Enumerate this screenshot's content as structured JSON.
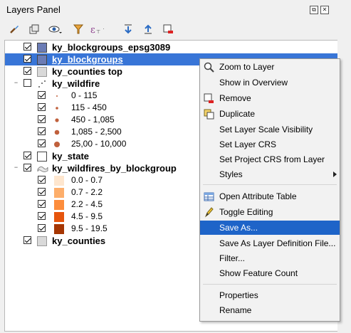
{
  "panel": {
    "title": "Layers Panel"
  },
  "window_buttons": {
    "float": "⧉",
    "close": "✕"
  },
  "layers": [
    {
      "label": "ky_blockgroups_epsg3089",
      "checked": true,
      "swatch": "#6b7cb5"
    },
    {
      "label": "ky_blockgroups",
      "checked": true,
      "swatch": "#6b7cb5",
      "selected": true
    },
    {
      "label": "ky_counties top",
      "checked": true,
      "swatch": "#d9d9d9"
    },
    {
      "label": "ky_wildfire",
      "checked": false
    },
    {
      "label": "ky_state",
      "checked": true
    },
    {
      "label": "ky_wildfires_by_blockgroup",
      "checked": true
    },
    {
      "label": "ky_counties",
      "checked": true,
      "swatch": "#d9d9d9"
    }
  ],
  "wildfire_classes": [
    {
      "label": "0 - 115",
      "color": "#c0603c"
    },
    {
      "label": "115 - 450",
      "color": "#c0603c"
    },
    {
      "label": "450 - 1,085",
      "color": "#c0603c"
    },
    {
      "label": "1,085 - 2,500",
      "color": "#c0603c"
    },
    {
      "label": "25,00 - 10,000",
      "color": "#c0603c"
    }
  ],
  "blockgroup_classes": [
    {
      "label": "0.0 - 0.7",
      "color": "#fee6ce"
    },
    {
      "label": "0.7 - 2.2",
      "color": "#fdae6b"
    },
    {
      "label": "2.2 - 4.5",
      "color": "#fd8d3c"
    },
    {
      "label": "4.5 - 9.5",
      "color": "#e6550d"
    },
    {
      "label": "9.5 - 19.5",
      "color": "#a63603"
    }
  ],
  "context_menu": {
    "items": [
      {
        "label": "Zoom to Layer",
        "icon": "zoom-icon"
      },
      {
        "label": "Show in Overview"
      },
      {
        "label": "Remove",
        "icon": "remove-icon"
      },
      {
        "label": "Duplicate",
        "icon": "duplicate-icon"
      },
      {
        "label": "Set Layer Scale Visibility"
      },
      {
        "label": "Set Layer CRS"
      },
      {
        "label": "Set Project CRS from Layer"
      },
      {
        "label": "Styles",
        "submenu": true
      },
      {
        "label": "Open Attribute Table",
        "icon": "table-icon"
      },
      {
        "label": "Toggle Editing",
        "icon": "pencil-icon"
      },
      {
        "label": "Save As...",
        "highlighted": true
      },
      {
        "label": "Save As Layer Definition File..."
      },
      {
        "label": "Filter..."
      },
      {
        "label": "Show Feature Count"
      },
      {
        "label": "Properties"
      },
      {
        "label": "Rename"
      }
    ]
  }
}
